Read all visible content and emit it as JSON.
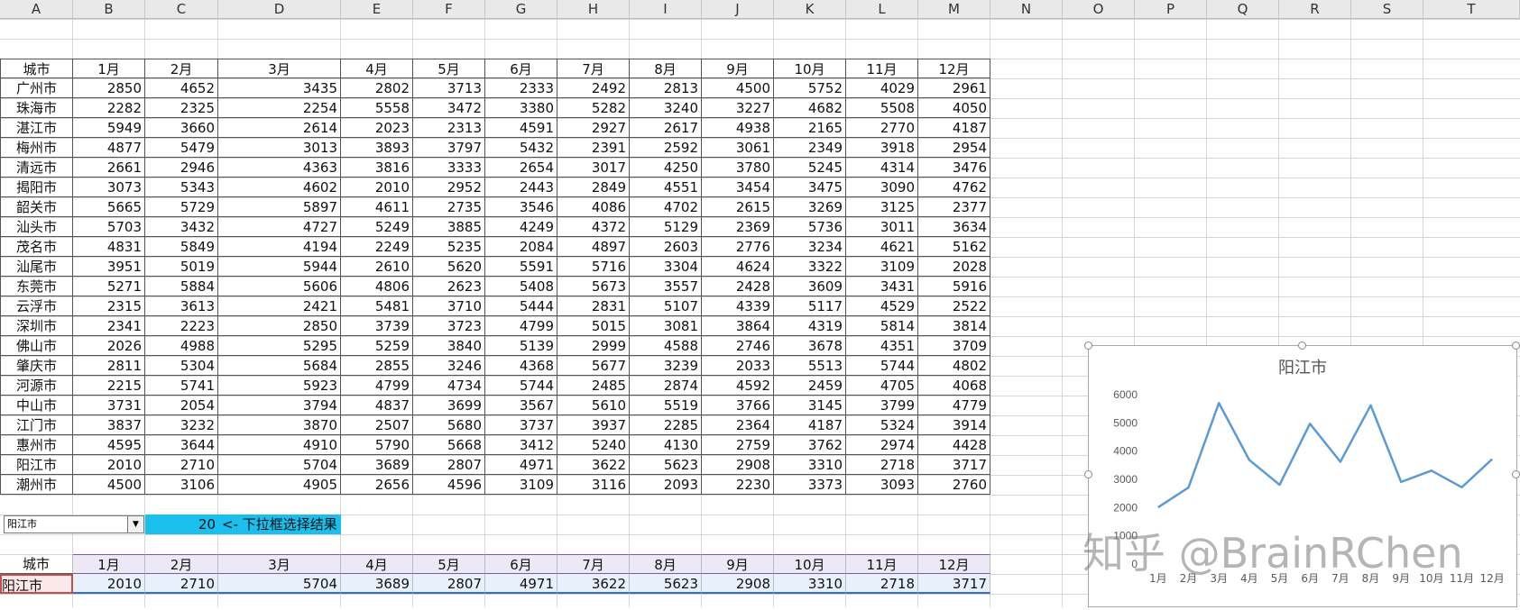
{
  "columns": [
    "A",
    "B",
    "C",
    "D",
    "E",
    "F",
    "G",
    "H",
    "I",
    "J",
    "K",
    "L",
    "M",
    "N",
    "O",
    "P",
    "Q",
    "R",
    "S",
    "T"
  ],
  "table": {
    "headers": [
      "城市",
      "1月",
      "2月",
      "3月",
      "4月",
      "5月",
      "6月",
      "7月",
      "8月",
      "9月",
      "10月",
      "11月",
      "12月"
    ],
    "rows": [
      [
        "广州市",
        2850,
        4652,
        3435,
        2802,
        3713,
        2333,
        2492,
        2813,
        4500,
        5752,
        4029,
        2961
      ],
      [
        "珠海市",
        2282,
        2325,
        2254,
        5558,
        3472,
        3380,
        5282,
        3240,
        3227,
        4682,
        5508,
        4050
      ],
      [
        "湛江市",
        5949,
        3660,
        2614,
        2023,
        2313,
        4591,
        2927,
        2617,
        4938,
        2165,
        2770,
        4187
      ],
      [
        "梅州市",
        4877,
        5479,
        3013,
        3893,
        3797,
        5432,
        2391,
        2592,
        3061,
        2349,
        3918,
        2954
      ],
      [
        "清远市",
        2661,
        2946,
        4363,
        3816,
        3333,
        2654,
        3017,
        4250,
        3780,
        5245,
        4314,
        3476
      ],
      [
        "揭阳市",
        3073,
        5343,
        4602,
        2010,
        2952,
        2443,
        2849,
        4551,
        3454,
        3475,
        3090,
        4762
      ],
      [
        "韶关市",
        5665,
        5729,
        5897,
        4611,
        2735,
        3546,
        4086,
        4702,
        2615,
        3269,
        3125,
        2377
      ],
      [
        "汕头市",
        5703,
        3432,
        4727,
        5249,
        3885,
        4249,
        4372,
        5129,
        2369,
        5736,
        3011,
        3634
      ],
      [
        "茂名市",
        4831,
        5849,
        4194,
        2249,
        5235,
        2084,
        4897,
        2603,
        2776,
        3234,
        4621,
        5162
      ],
      [
        "汕尾市",
        3951,
        5019,
        5944,
        2610,
        5620,
        5591,
        5716,
        3304,
        4624,
        3322,
        3109,
        2028
      ],
      [
        "东莞市",
        5271,
        5884,
        5606,
        4806,
        2623,
        5408,
        5673,
        3557,
        2428,
        3609,
        3431,
        5916
      ],
      [
        "云浮市",
        2315,
        3613,
        2421,
        5481,
        3710,
        5444,
        2831,
        5107,
        4339,
        5117,
        4529,
        2522
      ],
      [
        "深圳市",
        2341,
        2223,
        2850,
        3739,
        3723,
        4799,
        5015,
        3081,
        3864,
        4319,
        5814,
        3814
      ],
      [
        "佛山市",
        2026,
        4988,
        5295,
        5259,
        3840,
        5139,
        2999,
        4588,
        2746,
        3678,
        4351,
        3709
      ],
      [
        "肇庆市",
        2811,
        5304,
        5684,
        2855,
        3246,
        4368,
        5677,
        3239,
        2033,
        5513,
        5744,
        4802
      ],
      [
        "河源市",
        2215,
        5741,
        5923,
        4799,
        4734,
        5744,
        2485,
        2874,
        4592,
        2459,
        4705,
        4068
      ],
      [
        "中山市",
        3731,
        2054,
        3794,
        4837,
        3699,
        3567,
        5610,
        5519,
        3766,
        3145,
        3799,
        4779
      ],
      [
        "江门市",
        3837,
        3232,
        3870,
        2507,
        5680,
        3737,
        3937,
        2285,
        2364,
        4187,
        5324,
        3914
      ],
      [
        "惠州市",
        4595,
        3644,
        4910,
        5790,
        5668,
        3412,
        5240,
        4130,
        2759,
        3762,
        2974,
        4428
      ],
      [
        "阳江市",
        2010,
        2710,
        5704,
        3689,
        2807,
        4971,
        3622,
        5623,
        2908,
        3310,
        2718,
        3717
      ],
      [
        "潮州市",
        4500,
        3106,
        4905,
        2656,
        4596,
        3109,
        3116,
        2093,
        2230,
        3373,
        3093,
        2760
      ]
    ]
  },
  "selector": {
    "dropdown_value": "阳江市",
    "index_value": "20",
    "hint_text": "<- 下拉框选择结果"
  },
  "result": {
    "headers": [
      "城市",
      "1月",
      "2月",
      "3月",
      "4月",
      "5月",
      "6月",
      "7月",
      "8月",
      "9月",
      "10月",
      "11月",
      "12月"
    ],
    "row": [
      "阳江市",
      2010,
      2710,
      5704,
      3689,
      2807,
      4971,
      3622,
      5623,
      2908,
      3310,
      2718,
      3717
    ]
  },
  "chart_data": {
    "type": "line",
    "title": "阳江市",
    "categories": [
      "1月",
      "2月",
      "3月",
      "4月",
      "5月",
      "6月",
      "7月",
      "8月",
      "9月",
      "10月",
      "11月",
      "12月"
    ],
    "values": [
      2010,
      2710,
      5704,
      3689,
      2807,
      4971,
      3622,
      5623,
      2908,
      3310,
      2718,
      3717
    ],
    "yticks": [
      "0",
      "1000",
      "2000",
      "3000",
      "4000",
      "5000",
      "6000"
    ],
    "ylim": [
      0,
      6000
    ],
    "line_color": "#5b9bd5"
  },
  "watermark": "知乎 @BrainRChen",
  "colors": {
    "cyan": "#1bbfee",
    "result_header_bg": "#ede8f6",
    "result_row_bg": "#e8f0fb",
    "result_border": "#7b5aa6",
    "selected_cell_border": "#c0504d"
  }
}
